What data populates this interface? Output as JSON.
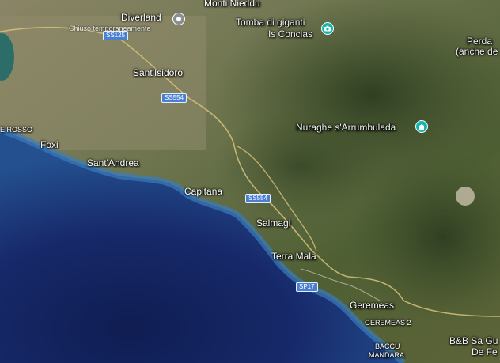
{
  "map": {
    "colors": {
      "sea_deep": "#0f1d52",
      "sea_shallow": "#2f6aa8",
      "land": "#5b6a3c",
      "road": "#d8c27a"
    },
    "places": {
      "monti_nieddu": "Monti Nieddu",
      "diverland": "Diverland",
      "closed_notice": "Chiuso temporaneamente",
      "tomba_line1": "Tomba di giganti",
      "tomba_line2": "Is Concias",
      "perda_line1": "Perda",
      "perda_line2": "(anche de",
      "santisidoro": "Sant'Isidoro",
      "nuraghe": "Nuraghe s'Arrumbulada",
      "rosso": "E ROSSO",
      "foxi": "Foxi",
      "santandrea": "Sant'Andrea",
      "capitana": "Capitana",
      "salmagi": "Salmagi",
      "terra_mala": "Terra Mala",
      "geremeas": "Geremeas",
      "geremeas2": "GEREMEAS 2",
      "baccu_line1": "BACCU",
      "baccu_line2": "MANDARA",
      "bb_line1": "B&B Sa Gu",
      "bb_line2": "De Fe"
    },
    "roads": {
      "ss125": "SS125",
      "ss554_a": "SS554",
      "ss554_b": "SS554",
      "sp17": "SP17"
    },
    "icons": [
      "diverland-pin-icon",
      "camera-icon",
      "nuraghe-monument-icon"
    ]
  }
}
